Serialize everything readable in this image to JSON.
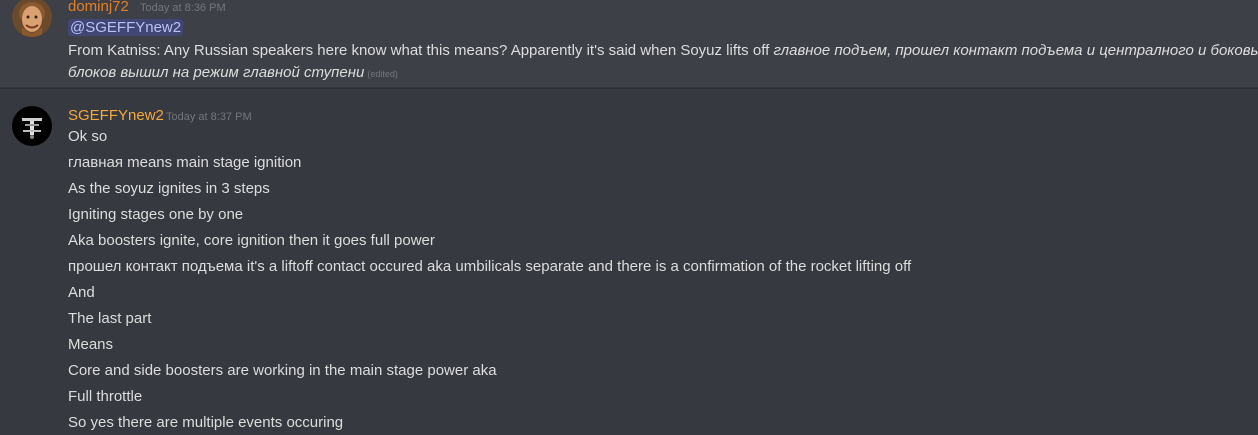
{
  "messages": [
    {
      "username": "dominj72",
      "timestamp": "Today at 8:36 PM",
      "mention": "@SGEFFYnew2",
      "text_plain": "From Katniss: Any Russian speakers here know what this means? Apparently it's said when Soyuz lifts off ",
      "text_italic_1": "главное подъем, прошел контакт подъема и централного и боковых",
      "text_italic_2": "блоков вышил на режим главной ступени",
      "edited": "(edited)"
    },
    {
      "username": "SGEFFYnew2",
      "timestamp": "Today at 8:37 PM",
      "lines": [
        "Ok so",
        "главная means main stage ignition",
        "As the soyuz ignites in 3 steps",
        "Igniting stages one by one",
        "Aka boosters ignite, core ignition then it goes full power",
        "прошел контакт подъема it's a liftoff contact occured aka umbilicals separate and there is a confirmation of the rocket lifting off",
        "And",
        "The last part",
        "Means",
        "Core and side boosters are working in the main stage power aka",
        "Full throttle",
        "So yes there are multiple events occuring"
      ]
    }
  ]
}
